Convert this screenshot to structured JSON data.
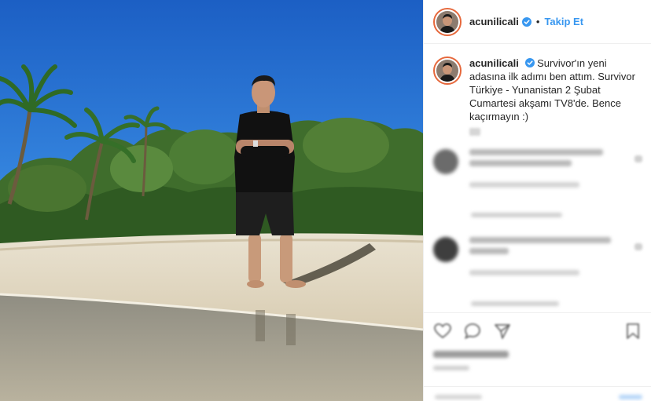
{
  "post": {
    "username": "acunilicali",
    "follow_label": "Takip Et",
    "dot": "•",
    "caption_username": "acunilicali",
    "caption_text": "Survivor'ın yeni adasına ilk adımı ben attım. Survivor Türkiye - Yunanistan 2 Şubat Cumartesi akşamı TV8'de. Bence kaçırmayın :)"
  },
  "icons": {
    "verified": "verified-badge-icon",
    "like": "heart-icon",
    "comment": "comment-bubble-icon",
    "share": "share-icon",
    "save": "bookmark-icon"
  },
  "colors": {
    "accent": "#3897f0",
    "verified": "#3897f0",
    "text": "#262626",
    "border": "#efefef",
    "story_ring": "#e6683c"
  }
}
